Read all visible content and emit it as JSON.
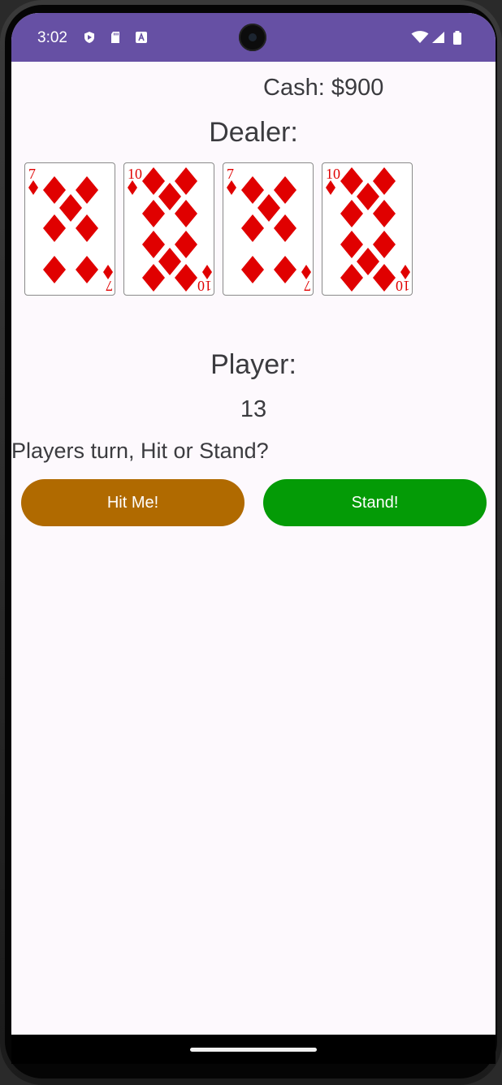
{
  "status_bar": {
    "time": "3:02",
    "left_icons": [
      "play-protect-icon",
      "sd-card-icon",
      "accessibility-a-icon"
    ],
    "right_icons": [
      "wifi-icon",
      "signal-icon",
      "battery-icon"
    ],
    "background_color": "#6650a4"
  },
  "game": {
    "cash_text": "Cash: $900",
    "dealer_label": "Dealer:",
    "dealer_cards": [
      {
        "rank": "7",
        "suit": "diamonds"
      },
      {
        "rank": "10",
        "suit": "diamonds"
      },
      {
        "rank": "7",
        "suit": "diamonds"
      },
      {
        "rank": "10",
        "suit": "diamonds"
      }
    ],
    "player_label": "Player:",
    "player_score": "13",
    "turn_message": "Players turn, Hit or Stand?",
    "hit_button_label": "Hit Me!",
    "stand_button_label": "Stand!",
    "hit_button_color": "#b06a00",
    "stand_button_color": "#049b06",
    "suit_color": "#e00000"
  }
}
